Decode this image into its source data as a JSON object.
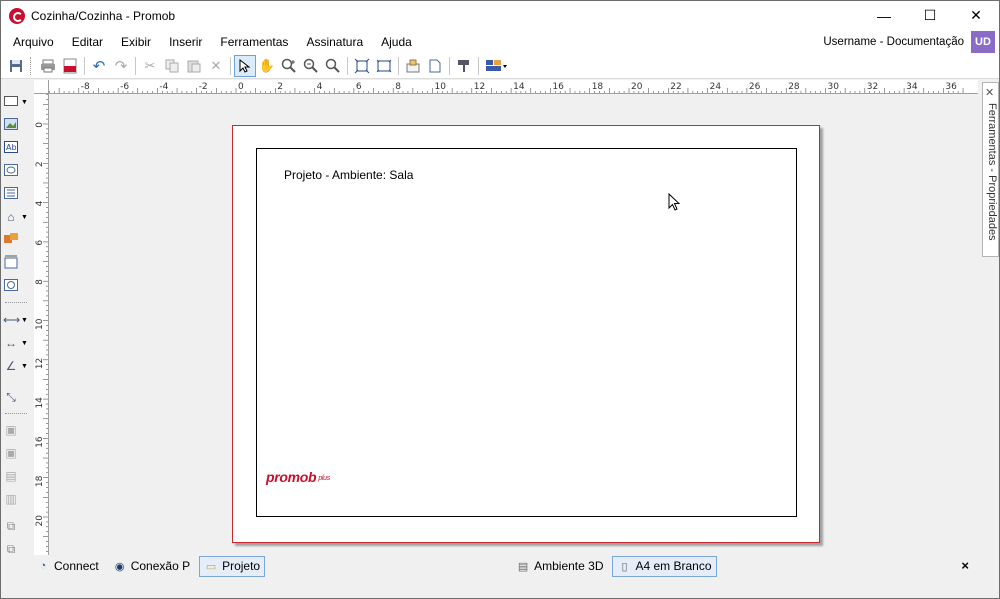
{
  "window": {
    "title": "Cozinha/Cozinha - Promob",
    "minimize": "—",
    "maximize": "☐",
    "close": "✕"
  },
  "menu": {
    "items": [
      "Arquivo",
      "Editar",
      "Exibir",
      "Inserir",
      "Ferramentas",
      "Assinatura",
      "Ajuda"
    ],
    "user_name": "Username - Documentação",
    "user_initials": "UD"
  },
  "toolbar": {
    "icons": [
      "save-icon",
      "print-icon",
      "pdf-icon",
      "undo-icon",
      "redo-icon",
      "cut-icon",
      "copy-icon",
      "paste-icon",
      "delete-icon",
      "select-icon",
      "pan-icon",
      "zoom-in-icon",
      "zoom-out-icon",
      "zoom-icon",
      "fit-page-icon",
      "fit-all-icon",
      "stamp-icon",
      "page-icon",
      "paint-icon",
      "layout-icon"
    ],
    "pdf_label": "PDF"
  },
  "ruler": {
    "top_labels": [
      "-8",
      "-6",
      "-4",
      "-2",
      "0",
      "2",
      "4",
      "6",
      "8",
      "10",
      "12",
      "14",
      "16",
      "18",
      "20",
      "22",
      "24",
      "26",
      "28",
      "30",
      "32",
      "34",
      "36"
    ],
    "left_labels": [
      "0",
      "2",
      "4",
      "6",
      "8",
      "10",
      "12",
      "14",
      "16",
      "18",
      "20"
    ]
  },
  "page": {
    "project_title": "Projeto - Ambiente: Sala",
    "logo_text": "promob",
    "logo_suffix": "plus"
  },
  "side_panel": {
    "label": "Ferramentas - Propriedades"
  },
  "bottom_tabs": {
    "left": [
      {
        "label": "Connect",
        "icon": "connect-icon"
      },
      {
        "label": "Conexão P",
        "icon": "conexao-icon"
      },
      {
        "label": "Projeto",
        "icon": "folder-icon",
        "active": true
      }
    ],
    "right": [
      {
        "label": "Ambiente 3D",
        "icon": "ambiente-3d-icon"
      },
      {
        "label": "A4 em Branco",
        "icon": "a4-icon",
        "active": true
      }
    ],
    "close": "×"
  },
  "colors": {
    "brand_red": "#c8102e",
    "user_badge": "#8a6cc7",
    "active_tab_border": "#7aa7d6"
  }
}
